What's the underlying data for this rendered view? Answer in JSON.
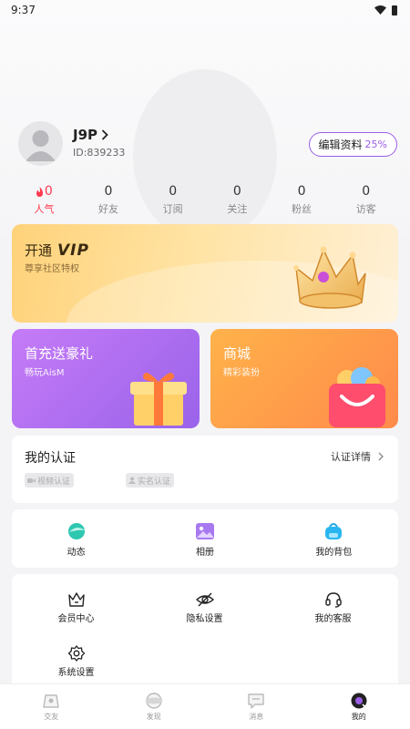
{
  "status_bar": {
    "time": "9:37",
    "icons": [
      "wifi-icon",
      "battery-icon"
    ]
  },
  "profile": {
    "username": "J9P",
    "id": "ID:839233",
    "edit_label": "编辑资料",
    "edit_percent": "25%"
  },
  "stats": [
    {
      "value": "0",
      "label": "人气",
      "icon": "flame-icon",
      "color": "#ff3a4f"
    },
    {
      "value": "0",
      "label": "好友"
    },
    {
      "value": "0",
      "label": "订阅"
    },
    {
      "value": "0",
      "label": "关注"
    },
    {
      "value": "0",
      "label": "粉丝"
    },
    {
      "value": "0",
      "label": "访客"
    }
  ],
  "vip": {
    "title_prefix": "开通",
    "title_vip": "VIP",
    "subtitle": "尊享社区特权"
  },
  "promos": {
    "recharge": {
      "title": "首充送豪礼",
      "subtitle": "畅玩AisM"
    },
    "mall": {
      "title": "商城",
      "subtitle": "精彩装扮"
    }
  },
  "certification": {
    "title": "我的认证",
    "detail": "认证详情",
    "tags": {
      "video": "视频认证",
      "realname": "实名认证"
    }
  },
  "quick_actions": [
    {
      "label": "动态",
      "icon": "moments-icon"
    },
    {
      "label": "相册",
      "icon": "album-icon"
    },
    {
      "label": "我的背包",
      "icon": "backpack-icon"
    }
  ],
  "menu": [
    {
      "label": "会员中心",
      "icon": "crown-icon"
    },
    {
      "label": "隐私设置",
      "icon": "eye-off-icon"
    },
    {
      "label": "我的客服",
      "icon": "headset-icon"
    },
    {
      "label": "系统设置",
      "icon": "gear-icon"
    }
  ],
  "tabs": [
    {
      "label": "交友",
      "icon": "friends-icon"
    },
    {
      "label": "发现",
      "icon": "discover-icon"
    },
    {
      "label": "消息",
      "icon": "message-icon"
    },
    {
      "label": "我的",
      "icon": "profile-icon",
      "active": true
    }
  ],
  "colors": {
    "accent": "#9b5de5",
    "hot": "#ff3a4f",
    "vip_gold": "#ffd27a",
    "recharge_purple": "#9a63ea",
    "mall_orange": "#ff8a4b"
  }
}
